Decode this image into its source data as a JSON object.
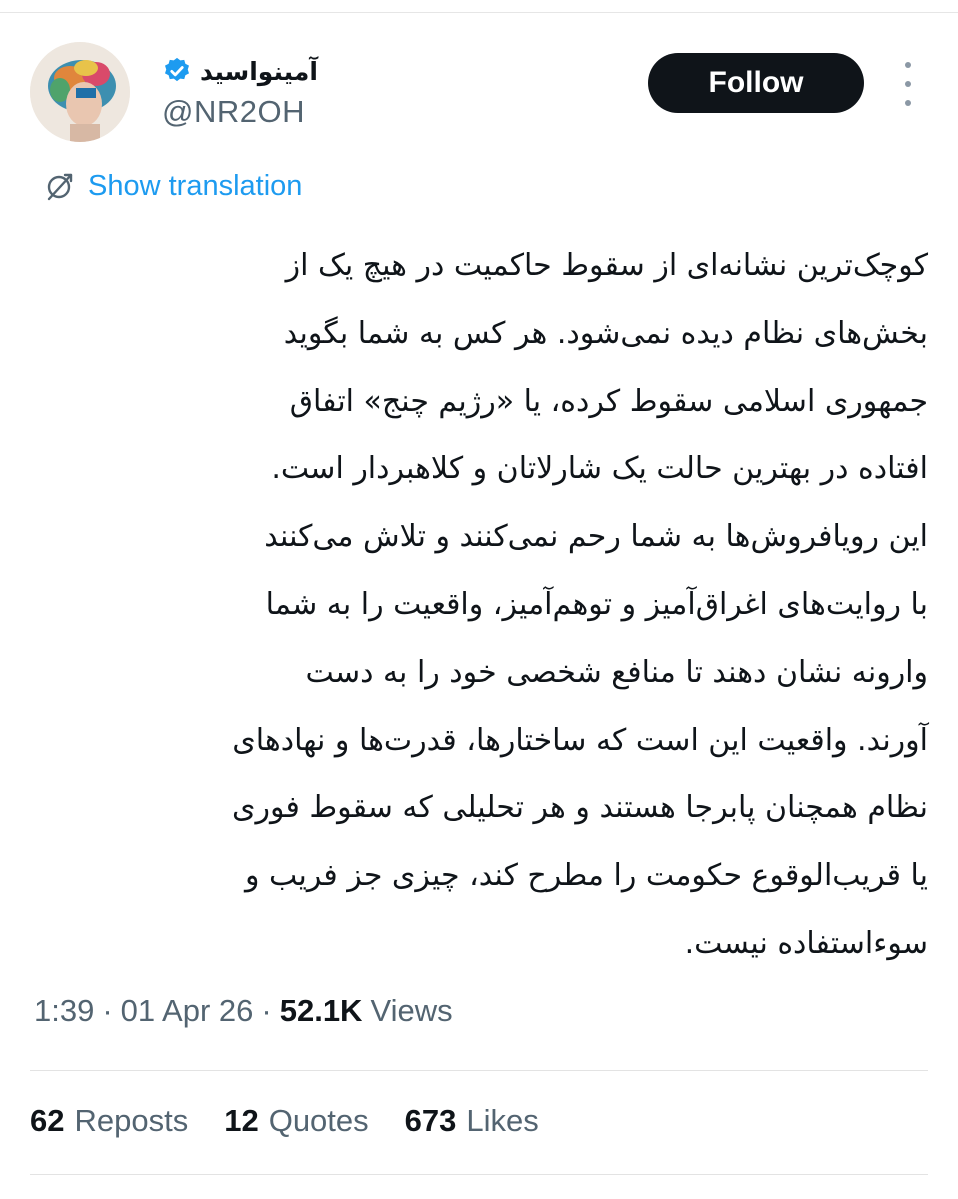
{
  "author": {
    "display_name": "آمینواسید",
    "handle": "@NR2OH",
    "verified": true,
    "avatar_icon": "profile-avatar"
  },
  "actions": {
    "follow_label": "Follow",
    "more_icon": "more-dots-icon"
  },
  "translation": {
    "label": "Show translation",
    "icon": "translate-icon"
  },
  "tweet": {
    "lines": [
      "کوچک‌ترین نشانه‌ای از سقوط حاکمیت در هیچ یک از",
      "بخش‌های نظام دیده نمی‌شود. هر کس به شما بگوید",
      "جمهوری اسلامی سقوط کرده، یا «رژیم چنج» اتفاق",
      "افتاده در بهترین حالت یک شارلاتان و کلاهبردار است.",
      "این رویافروش‌ها به شما رحم نمی‌کنند و تلاش می‌کنند",
      "با روایت‌های اغراق‌آمیز و توهم‌آمیز، واقعیت را به شما",
      "وارونه نشان دهند تا منافع شخصی خود را به دست",
      "آورند. واقعیت این است که ساختارها، قدرت‌ها و نهادهای",
      "نظام همچنان پابرجا هستند و هر تحلیلی که سقوط فوری",
      "یا قریب‌الوقوع حکومت را مطرح کند، چیزی جز فریب و",
      "سوءاستفاده نیست."
    ]
  },
  "meta": {
    "time": "1:39",
    "separator": "·",
    "date": "01 Apr 26",
    "views_count": "52.1K",
    "views_label": "Views"
  },
  "stats": {
    "reposts_count": "62",
    "reposts_label": "Reposts",
    "quotes_count": "12",
    "quotes_label": "Quotes",
    "likes_count": "673",
    "likes_label": "Likes"
  },
  "colors": {
    "accent": "#1d9bf0",
    "text": "#0f1419",
    "secondary": "#536471",
    "button_bg": "#0f1419"
  }
}
